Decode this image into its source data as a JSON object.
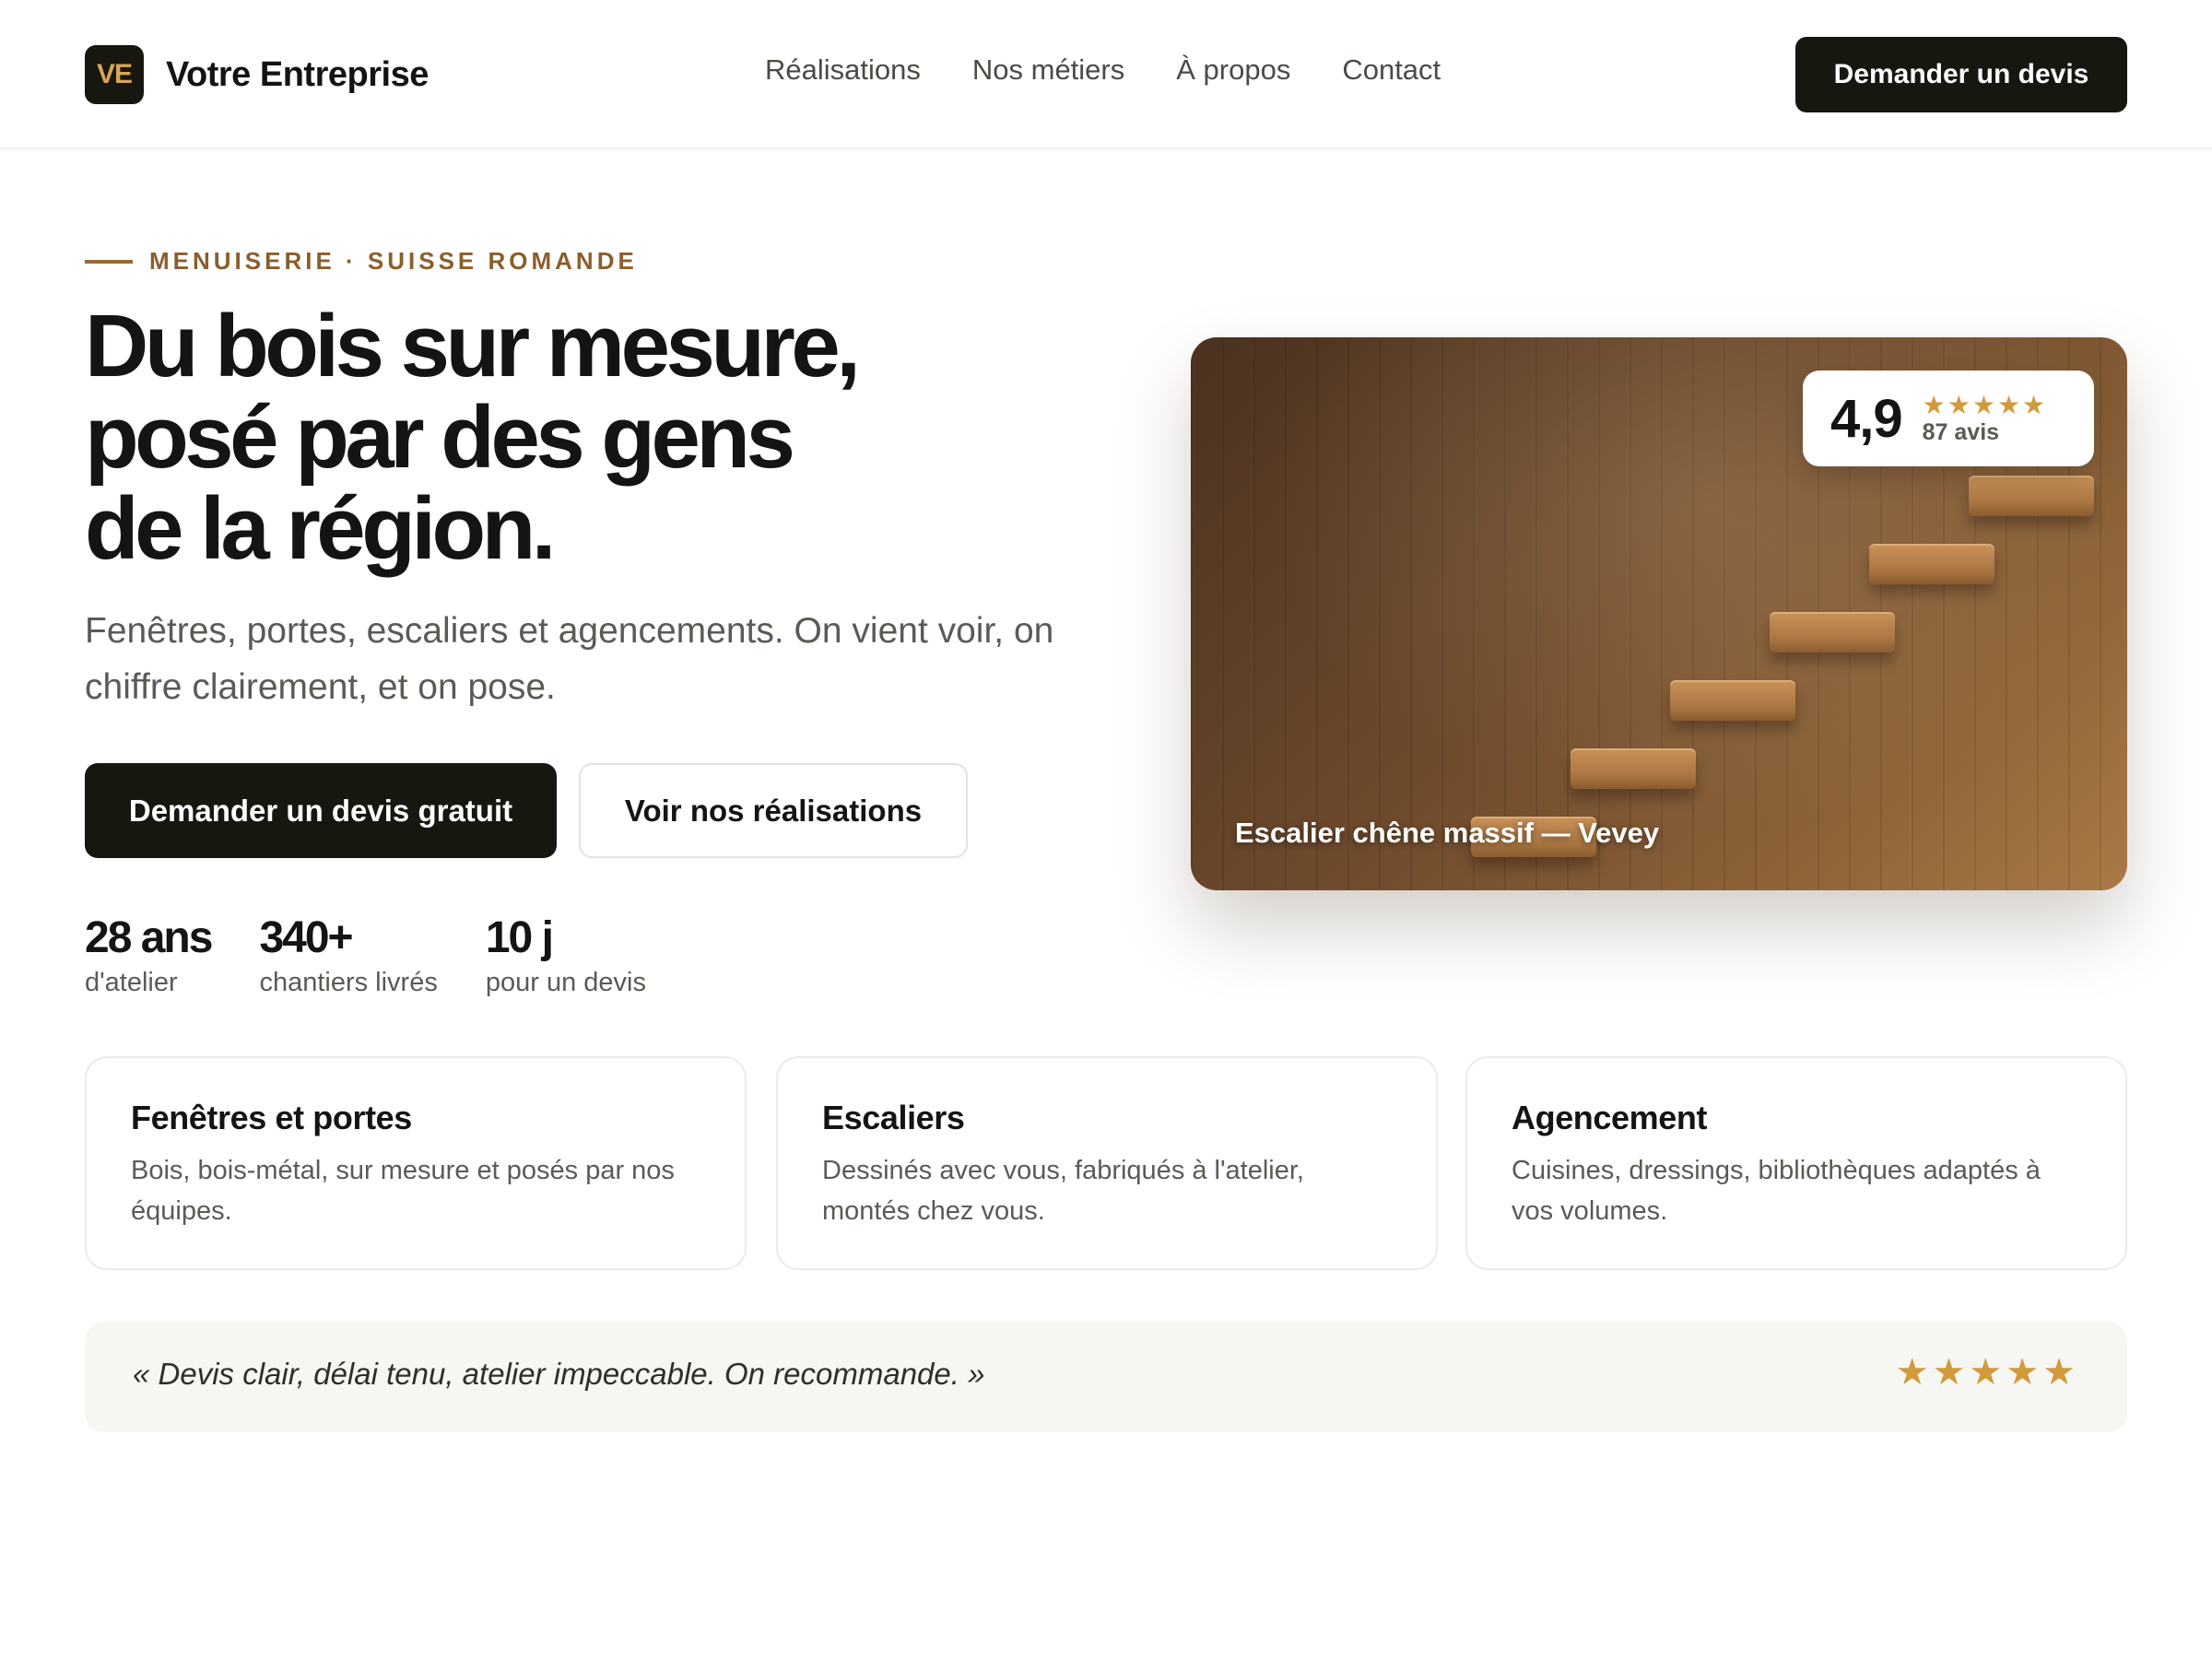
{
  "header": {
    "brand_initials": "VE",
    "brand_name": "Votre Entreprise",
    "nav": [
      "Réalisations",
      "Nos métiers",
      "À propos",
      "Contact"
    ],
    "cta_label": "Demander un devis"
  },
  "hero": {
    "eyebrow": "MENUISERIE · SUISSE ROMANDE",
    "title_lines": [
      "Du bois sur mesure,",
      "posé par des gens",
      "de la région."
    ],
    "subtitle": "Fenêtres, portes, escaliers et agencements. On vient voir, on chiffre clairement, et on pose.",
    "primary_cta": "Demander un devis gratuit",
    "secondary_cta": "Voir nos réalisations",
    "stats": [
      {
        "value": "28 ans",
        "label": "d'atelier"
      },
      {
        "value": "340+",
        "label": "chantiers livrés"
      },
      {
        "value": "10 j",
        "label": "pour un devis"
      }
    ],
    "image": {
      "caption": "Escalier chêne massif — Vevey",
      "rating_value": "4,9",
      "rating_stars": "★★★★★",
      "rating_count": "87 avis"
    }
  },
  "services": [
    {
      "title": "Fenêtres et portes",
      "description": "Bois, bois-métal, sur mesure et posés par nos équipes."
    },
    {
      "title": "Escaliers",
      "description": "Dessinés avec vous, fabriqués à l'atelier, montés chez vous."
    },
    {
      "title": "Agencement",
      "description": "Cuisines, dressings, bibliothèques adaptés à vos volumes."
    }
  ],
  "testimonial": {
    "quote": "« Devis clair, délai tenu, atelier impeccable. On recommande. »",
    "stars": "★★★★★"
  },
  "colors": {
    "accent": "#d19a3a",
    "brand_dark": "#17160f",
    "eyebrow": "#8b5e2b"
  }
}
